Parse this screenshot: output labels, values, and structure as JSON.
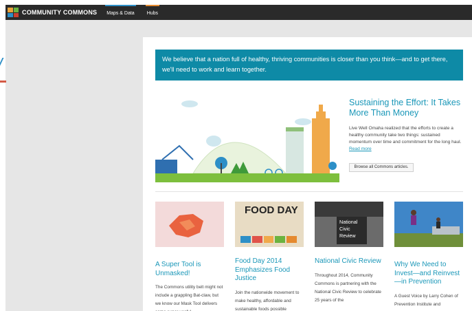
{
  "header": {
    "brand": "COMMUNITY COMMONS",
    "nav": [
      "Maps & Data",
      "Hubs"
    ]
  },
  "banner": {
    "text": "We believe that a nation full of healthy, thriving communities is closer than you think—and to get there, we'll need to work and learn together."
  },
  "feature": {
    "title": "Sustaining the Effort: It Takes More Than Money",
    "text": "Live Well Omaha realized that the efforts to create a healthy community take two things: sustained momentum over time and commitment for the long haul.",
    "read_more": "Read more",
    "button": "Browse all Commons articles."
  },
  "cards": [
    {
      "title": "A Super Tool is Unmasked!",
      "text": "The Commons utility belt might not include a grappling Bat-claw, but we know our Mask Tool delivers some super useful"
    },
    {
      "title": "Food Day 2014 Emphasizes Food Justice",
      "text": "Join the nationwide movement to make healthy, affordable and sustainable foods possible",
      "image_text": "FOOD DAY"
    },
    {
      "title": "National Civic Review",
      "text": "Throughout 2014, Community Commons is partnering with the National Civic Review to celebrate 25 years of the",
      "image_text": "National Civic Review"
    },
    {
      "title": "Why We Need to Invest—and Reinvest—in Prevention",
      "text": "A Guest Voice by Larry Cohen of Prevention Institute and"
    }
  ],
  "colors": {
    "accent": "#0e8aa6",
    "link": "#1a97b8",
    "topbar": "#2a2a2a"
  }
}
